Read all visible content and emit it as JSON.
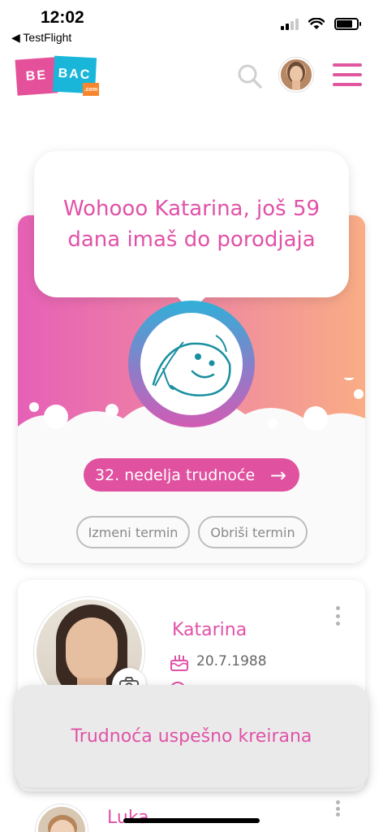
{
  "status_bar": {
    "time": "12:02",
    "back_label": "◀ TestFlight"
  },
  "header": {
    "logo_part1": "BE",
    "logo_part2": "BAC",
    "logo_part3": ".com",
    "search_icon": "search-icon",
    "menu_icon": "hamburger-icon"
  },
  "countdown": {
    "message": "Wohooo Katarina, još 59 dana imaš do porodjaja",
    "week_button": "32. nedelja trudnoće",
    "edit_button": "Izmeni termin",
    "delete_button": "Obriši termin"
  },
  "profile": {
    "name": "Katarina",
    "birth_date": "20.7.1988"
  },
  "child": {
    "name": "Luka"
  },
  "toast": {
    "message": "Trudnoća uspešno kreirana"
  },
  "colors": {
    "accent": "#e052a8",
    "brand_blue": "#1ab6d9",
    "brand_orange": "#f7872e"
  }
}
